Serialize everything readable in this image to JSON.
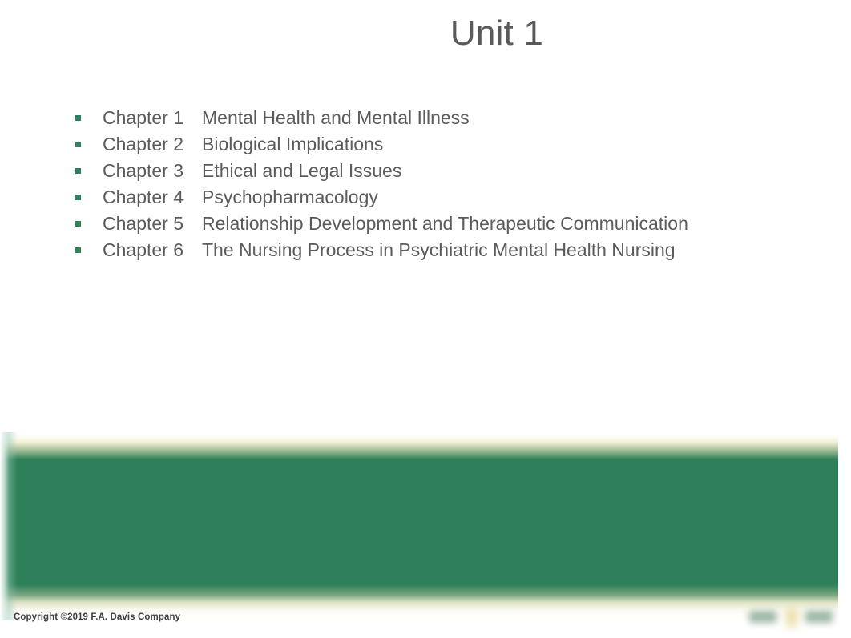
{
  "slide": {
    "title": "Unit 1",
    "chapters": [
      {
        "label": "Chapter 1",
        "title": "Mental Health and Mental Illness"
      },
      {
        "label": "Chapter 2",
        "title": "Biological Implications"
      },
      {
        "label": "Chapter 3",
        "title": "Ethical and Legal Issues"
      },
      {
        "label": "Chapter 4",
        "title": "Psychopharmacology"
      },
      {
        "label": "Chapter 5",
        "title": "Relationship Development and Therapeutic Communication"
      },
      {
        "label": "Chapter 6",
        "title": "The Nursing Process in Psychiatric Mental Health Nursing"
      }
    ],
    "footer": {
      "copyright": "Copyright ©2019 F.A. Davis Company",
      "logo_name": "fa-davis-company-logo"
    },
    "colors": {
      "brand_green": "#2d8059",
      "bullet_green": "#2d8059",
      "title_gray": "#5a5a5a",
      "body_gray": "#5b5b5b",
      "copyright_gray": "#3f3f3f",
      "logo_gold": "#e4c86c",
      "background": "#ffffff"
    }
  }
}
